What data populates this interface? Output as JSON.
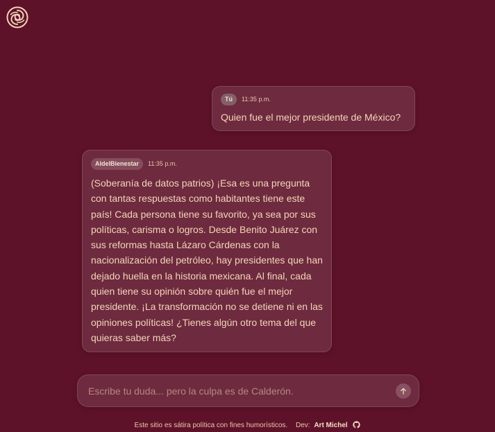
{
  "logo": {
    "icon": "logo-swirl-icon"
  },
  "messages": [
    {
      "role": "user",
      "sender": "Tú",
      "time": "11:35 p.m.",
      "text": "Quien fue el mejor presidente de México?"
    },
    {
      "role": "assistant",
      "sender": "AIdelBienestar",
      "time": "11:35 p.m.",
      "text": "(Soberanía de datos patrios) ¡Esa es una pregunta con tantas respuestas como habitantes tiene este país! Cada persona tiene su favorito, ya sea por sus políticas, carisma o logros. Desde Benito Juárez con sus reformas hasta Lázaro Cárdenas con la nacionalización del petróleo, hay presidentes que han dejado huella en la historia mexicana. Al final, cada quien tiene su opinión sobre quién fue el mejor presidente. ¡La transformación no se detiene ni en las opiniones políticas! ¿Tienes algún otro tema del que quieras saber más?"
    }
  ],
  "composer": {
    "placeholder": "Escribe tu duda... pero la culpa es de Calderón.",
    "value": "",
    "send_icon": "arrow-up-icon"
  },
  "footer": {
    "disclaimer": "Este sitio es sátira política con fines humorísticos.",
    "dev_label": "Dev:",
    "dev_name": "Art Michel",
    "github_icon": "github-icon"
  },
  "colors": {
    "background": "#5e1229",
    "text": "#f1d3b8",
    "accent": "#f6dcc4"
  }
}
